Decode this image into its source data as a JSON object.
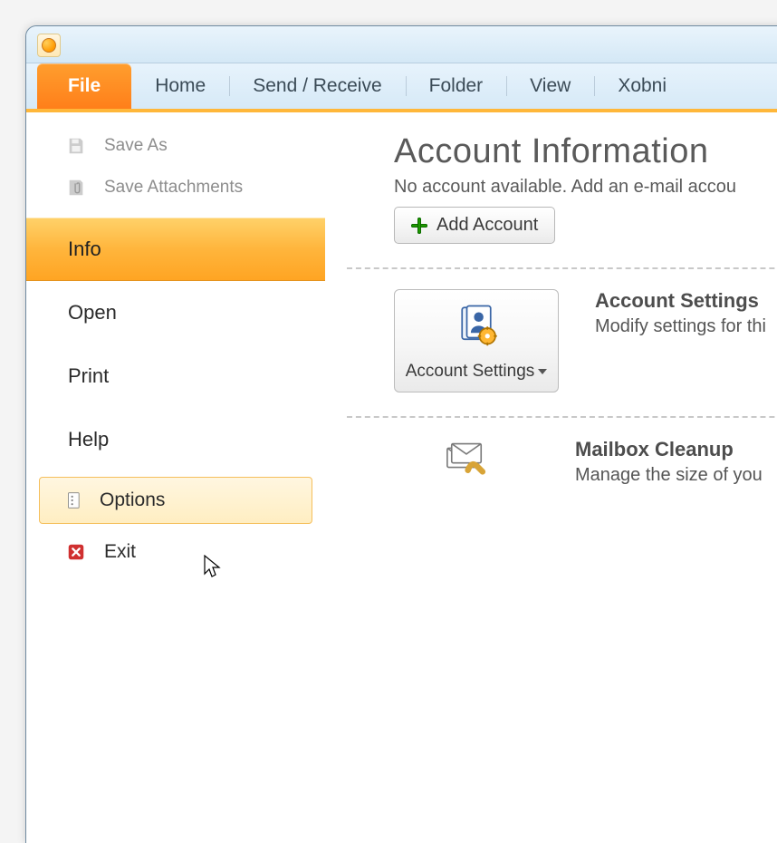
{
  "ribbon": {
    "file": "File",
    "tabs": [
      "Home",
      "Send / Receive",
      "Folder",
      "View",
      "Xobni"
    ]
  },
  "backstage": {
    "saveAs": "Save As",
    "saveAttachments": "Save Attachments",
    "info": "Info",
    "open": "Open",
    "print": "Print",
    "help": "Help",
    "options": "Options",
    "exit": "Exit"
  },
  "content": {
    "title": "Account Information",
    "subtext": "No account available. Add an e-mail accou",
    "addAccount": "Add Account",
    "accountSettings": {
      "button": "Account Settings",
      "heading": "Account Settings",
      "desc": "Modify settings for thi"
    },
    "mailboxCleanup": {
      "heading": "Mailbox Cleanup",
      "desc": "Manage the size of you"
    }
  }
}
